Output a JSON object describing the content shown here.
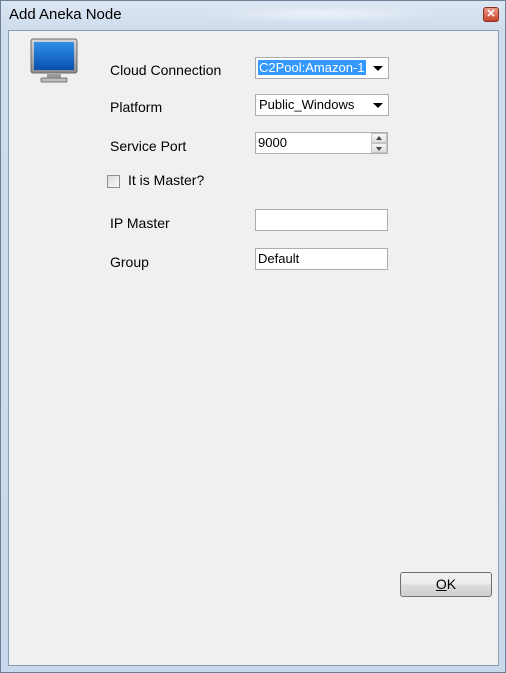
{
  "window": {
    "title": "Add Aneka Node"
  },
  "form": {
    "cloud_connection": {
      "label": "Cloud Connection",
      "value": "C2Pool:Amazon-1"
    },
    "platform": {
      "label": "Platform",
      "value": "Public_Windows"
    },
    "service_port": {
      "label": "Service Port",
      "value": "9000"
    },
    "is_master": {
      "label": "It is Master?",
      "checked": false
    },
    "ip_master": {
      "label": "IP Master",
      "value": ""
    },
    "group": {
      "label": "Group",
      "value": "Default"
    }
  },
  "buttons": {
    "ok_label_prefix": "",
    "ok_label_underlined": "O",
    "ok_label_suffix": "K"
  },
  "icons": {
    "title_close": "close-icon",
    "monitor": "monitor-icon"
  }
}
